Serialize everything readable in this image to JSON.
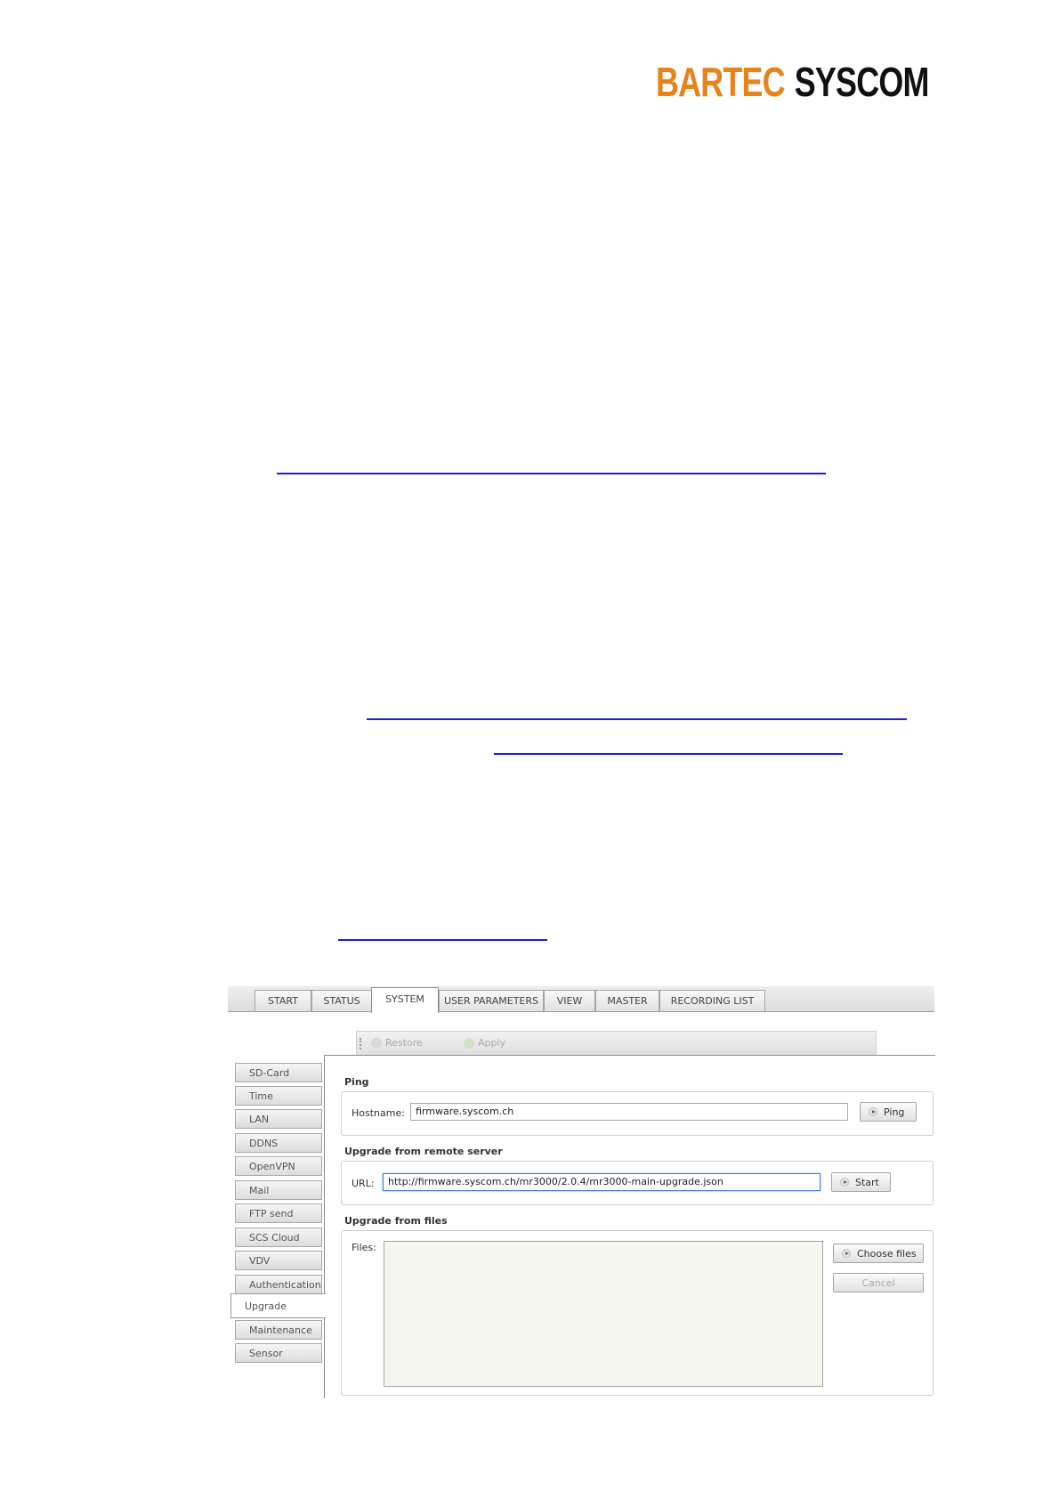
{
  "brand": {
    "part1": "BARTEC",
    "part2": "SYSCOM"
  },
  "nav": {
    "tabs": [
      {
        "label": "START"
      },
      {
        "label": "STATUS"
      },
      {
        "label": "SYSTEM"
      },
      {
        "label": "USER PARAMETERS"
      },
      {
        "label": "VIEW"
      },
      {
        "label": "MASTER"
      },
      {
        "label": "RECORDING LIST"
      }
    ],
    "active_tab": "SYSTEM"
  },
  "toolbar": {
    "restore_label": "Restore",
    "apply_label": "Apply"
  },
  "sidebar": {
    "items": [
      {
        "label": "SD-Card"
      },
      {
        "label": "Time"
      },
      {
        "label": "LAN"
      },
      {
        "label": "DDNS"
      },
      {
        "label": "OpenVPN"
      },
      {
        "label": "Mail"
      },
      {
        "label": "FTP send"
      },
      {
        "label": "SCS Cloud"
      },
      {
        "label": "VDV"
      },
      {
        "label": "Authentication"
      },
      {
        "label": "Upgrade"
      },
      {
        "label": "Maintenance"
      },
      {
        "label": "Sensor"
      }
    ],
    "active_item": "Upgrade"
  },
  "ping": {
    "title": "Ping",
    "hostname_label": "Hostname:",
    "hostname_value": "firmware.syscom.ch",
    "button_label": "Ping"
  },
  "remote": {
    "title": "Upgrade from remote server",
    "url_label": "URL:",
    "url_value": "http://firmware.syscom.ch/mr3000/2.0.4/mr3000-main-upgrade.json",
    "button_label": "Start"
  },
  "files": {
    "title": "Upgrade from files",
    "files_label": "Files:",
    "choose_label": "Choose files",
    "cancel_label": "Cancel"
  },
  "colors": {
    "brand_orange": "#e8831b",
    "brand_black": "#111111",
    "link_blue": "#1f1fd6"
  }
}
